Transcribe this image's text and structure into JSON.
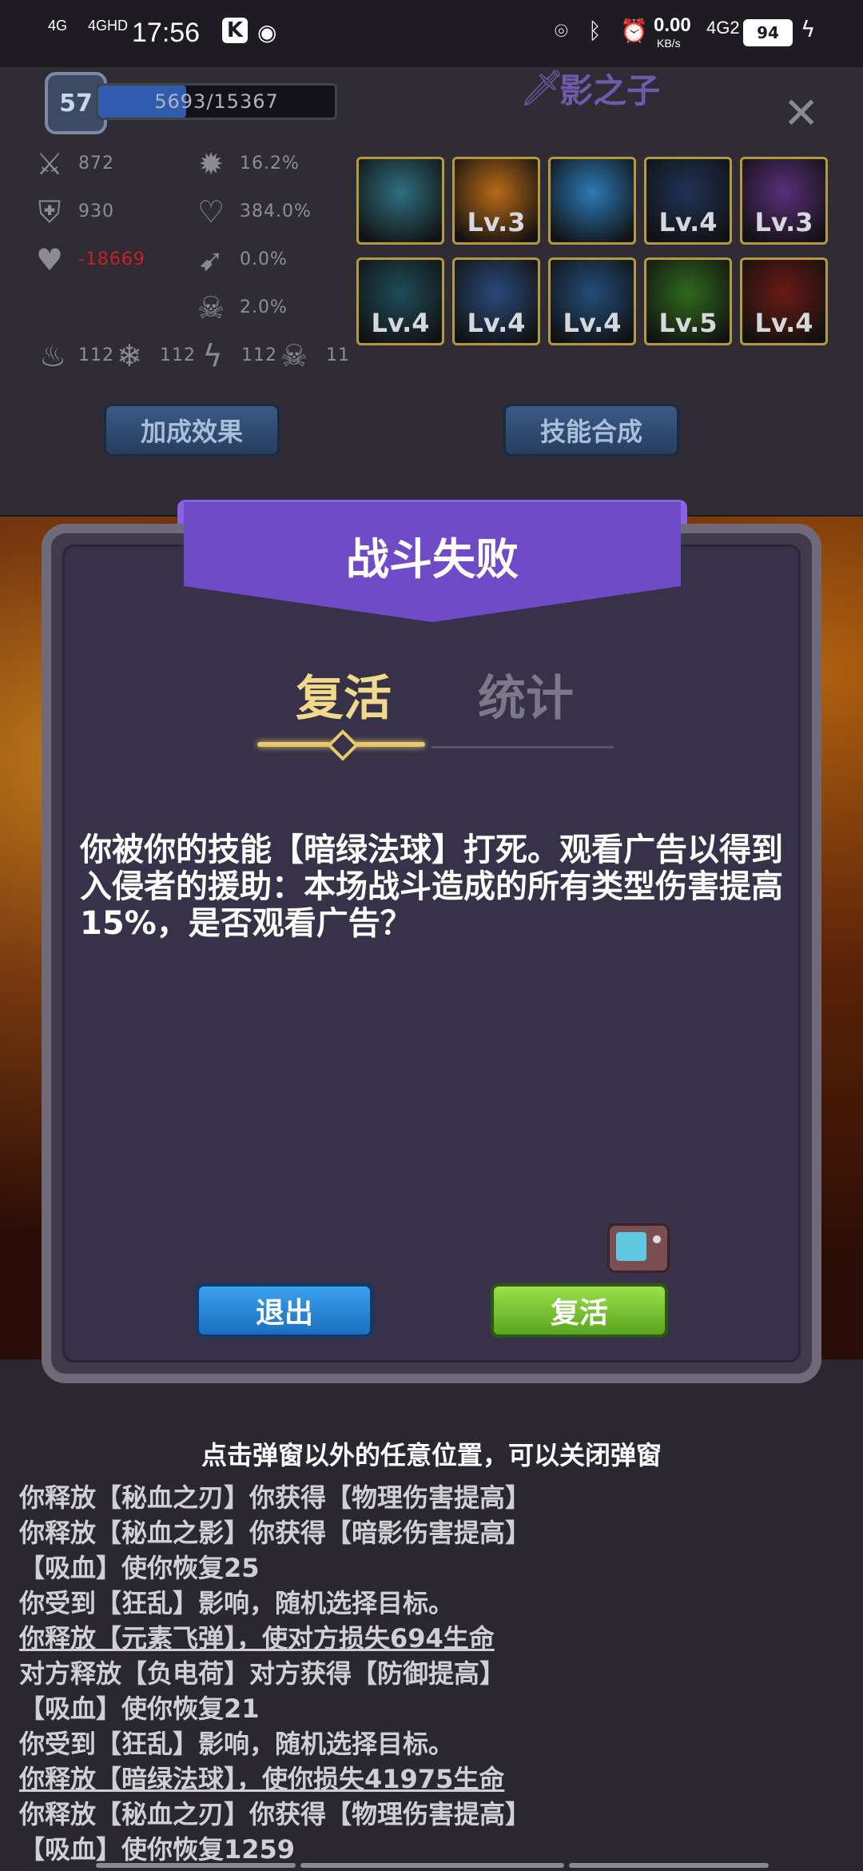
{
  "status_bar": {
    "time": "17:56",
    "net_left": "4G",
    "net_left2": "4GHD",
    "speed": "0.00",
    "speed_unit": "KB/s",
    "net_right": "4G2",
    "battery": "94"
  },
  "top_panel": {
    "level": "57",
    "exp": "5693/15367",
    "exp_fraction": 0.37,
    "character_name": "影之子",
    "stats": [
      {
        "icon": "sword-icon",
        "value": "872"
      },
      {
        "icon": "shield-icon",
        "value": "930"
      },
      {
        "icon": "heart-icon",
        "value": "-18669",
        "color": "#c92020"
      },
      {
        "icon": "crit-icon",
        "value": "16.2%"
      },
      {
        "icon": "crit-damage-icon",
        "value": "384.0%"
      },
      {
        "icon": "dodge-icon",
        "value": "0.0%"
      },
      {
        "icon": "skull-icon",
        "value": "2.0%"
      }
    ],
    "elements": [
      {
        "icon": "fire-icon",
        "value": "112"
      },
      {
        "icon": "ice-icon",
        "value": "112"
      },
      {
        "icon": "lightning-icon",
        "value": "112"
      },
      {
        "icon": "poison-skull-icon",
        "value": "11"
      }
    ],
    "skills": [
      {
        "name": "shield-skill",
        "level": "",
        "color": "#2f6f80"
      },
      {
        "name": "fire-pillar-skill",
        "level": "Lv.3",
        "color": "#b86a18"
      },
      {
        "name": "water-wave-skill",
        "level": "",
        "color": "#2c7ab8"
      },
      {
        "name": "shadow-strike-skill",
        "level": "Lv.4",
        "color": "#1f3356"
      },
      {
        "name": "dark-blade-skill",
        "level": "Lv.3",
        "color": "#5a2f7a"
      },
      {
        "name": "spike-skill",
        "level": "Lv.4",
        "color": "#1f4c5a"
      },
      {
        "name": "ice-crown-skill",
        "level": "Lv.4",
        "color": "#2a4a7a"
      },
      {
        "name": "wind-slash-skill",
        "level": "Lv.4",
        "color": "#234d7a"
      },
      {
        "name": "green-orb-skill",
        "level": "Lv.5",
        "color": "#2f6a1e"
      },
      {
        "name": "blood-spear-skill",
        "level": "Lv.4",
        "color": "#6a1a14"
      }
    ],
    "bonus_button": "加成效果",
    "merge_button": "技能合成"
  },
  "dialog": {
    "title": "战斗失败",
    "tab_revive": "复活",
    "tab_stats": "统计",
    "message": "你被你的技能【暗绿法球】打死。观看广告以得到入侵者的援助：本场战斗造成的所有类型伤害提高15%，是否观看广告？",
    "exit_button": "退出",
    "revive_button": "复活"
  },
  "hint": "点击弹窗以外的任意位置，可以关闭弹窗",
  "log": [
    {
      "text": "你释放【秘血之刃】你获得【物理伤害提高】",
      "underline": false
    },
    {
      "text": "你释放【秘血之影】你获得【暗影伤害提高】",
      "underline": false
    },
    {
      "text": "【吸血】使你恢复25",
      "underline": false
    },
    {
      "text": "你受到【狂乱】影响，随机选择目标。",
      "underline": false
    },
    {
      "text": "你释放【元素飞弹】，使对方损失694生命",
      "underline": true
    },
    {
      "text": "对方释放【负电荷】对方获得【防御提高】",
      "underline": false
    },
    {
      "text": "【吸血】使你恢复21",
      "underline": false
    },
    {
      "text": "你受到【狂乱】影响，随机选择目标。",
      "underline": false
    },
    {
      "text": "你释放【暗绿法球】，使你损失41975生命",
      "underline": true
    },
    {
      "text": "你释放【秘血之刃】你获得【物理伤害提高】",
      "underline": false
    },
    {
      "text": "【吸血】使你恢复1259",
      "underline": false
    }
  ]
}
